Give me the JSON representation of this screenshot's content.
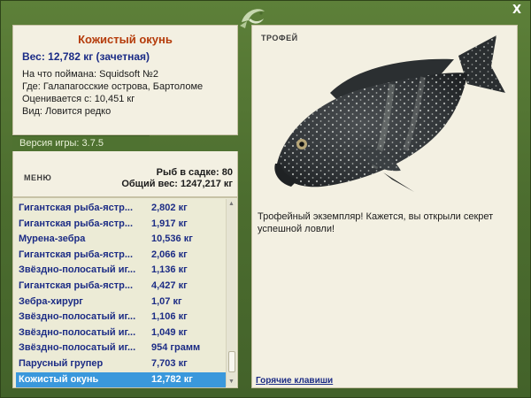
{
  "close_label": "X",
  "info": {
    "fish_name": "Кожистый окунь",
    "weight": "Вес: 12,782 кг (зачетная)",
    "bait": "На что поймана: Squidsoft №2",
    "location": "Где: Галапагосские острова, Бартоломе",
    "value": "Оценивается с: 10,451 кг",
    "rarity": "Вид: Ловится редко"
  },
  "version": "Версия игры: 3.7.5",
  "menu_label": "МЕНЮ",
  "stats": {
    "fish_in_cage": "Рыб в садке: 80",
    "total_weight": "Общий вес: 1247,217 кг"
  },
  "fish_list": [
    {
      "name": "Гигантская рыба-ястр...",
      "weight": "2,802 кг"
    },
    {
      "name": "Гигантская рыба-ястр...",
      "weight": "1,917 кг"
    },
    {
      "name": "Мурена-зебра",
      "weight": "10,536 кг"
    },
    {
      "name": "Гигантская рыба-ястр...",
      "weight": "2,066 кг"
    },
    {
      "name": "Звёздно-полосатый иг...",
      "weight": "1,136 кг"
    },
    {
      "name": "Гигантская рыба-ястр...",
      "weight": "4,427 кг"
    },
    {
      "name": "Зебра-хирург",
      "weight": "1,07 кг"
    },
    {
      "name": "Звёздно-полосатый иг...",
      "weight": "1,106 кг"
    },
    {
      "name": "Звёздно-полосатый иг...",
      "weight": "1,049 кг"
    },
    {
      "name": "Звёздно-полосатый иг...",
      "weight": "954 грамм"
    },
    {
      "name": "Парусный групер",
      "weight": "7,703 кг"
    },
    {
      "name": "Кожистый окунь",
      "weight": "12,782 кг"
    }
  ],
  "selected_index": 11,
  "trophy_label": "ТРОФЕЙ",
  "description": "Трофейный экземпляр! Кажется, вы открыли секрет успешной ловли!",
  "hotkeys_label": "Горячие клавиши",
  "colors": {
    "frame": "#4f7231",
    "panel": "#f3f0e2",
    "selected_row": "#3a98dc",
    "fish_name": "#b53c0b",
    "list_text": "#1c2c85"
  },
  "icons": [
    "close-icon",
    "logo-icon",
    "fish-trophy-image",
    "scroll-up-icon",
    "scroll-down-icon"
  ]
}
